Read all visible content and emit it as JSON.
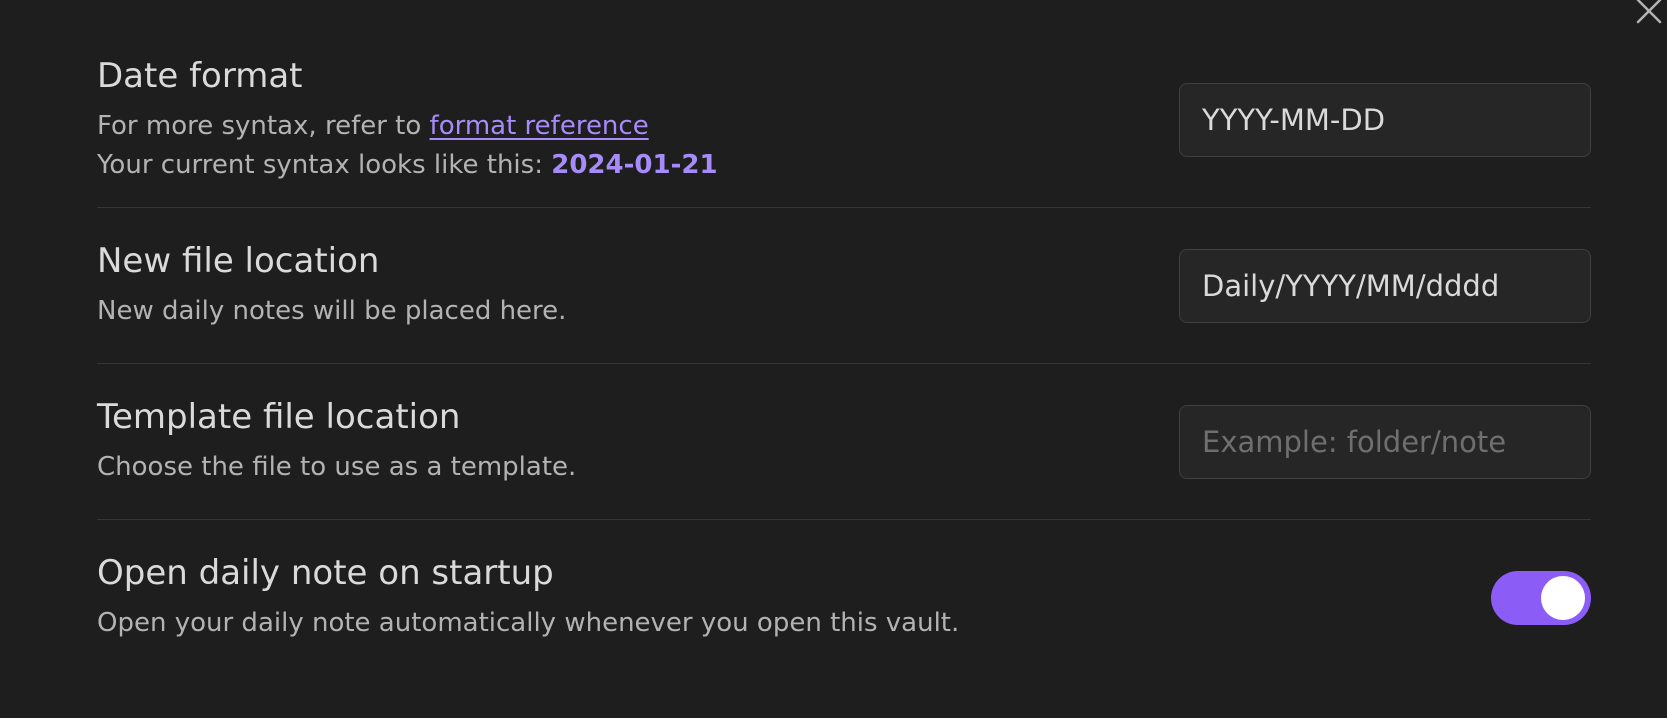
{
  "icons": {
    "close": "close-icon"
  },
  "colors": {
    "background": "#1e1e1e",
    "accent": "#8b5cf6",
    "link": "#a88bfa",
    "divider": "#363636"
  },
  "settings": {
    "date_format": {
      "name": "Date format",
      "desc_prefix": "For more syntax, refer to ",
      "link_text": "format reference",
      "desc_line2": "Your current syntax looks like this: ",
      "sample": "2024-01-21",
      "value": "YYYY-MM-DD"
    },
    "new_file_location": {
      "name": "New file location",
      "desc": "New daily notes will be placed here.",
      "value": "Daily/YYYY/MM/dddd"
    },
    "template_file_location": {
      "name": "Template file location",
      "desc": "Choose the file to use as a template.",
      "value": "",
      "placeholder": "Example: folder/note"
    },
    "open_on_startup": {
      "name": "Open daily note on startup",
      "desc": "Open your daily note automatically whenever you open this vault.",
      "enabled": true
    }
  }
}
